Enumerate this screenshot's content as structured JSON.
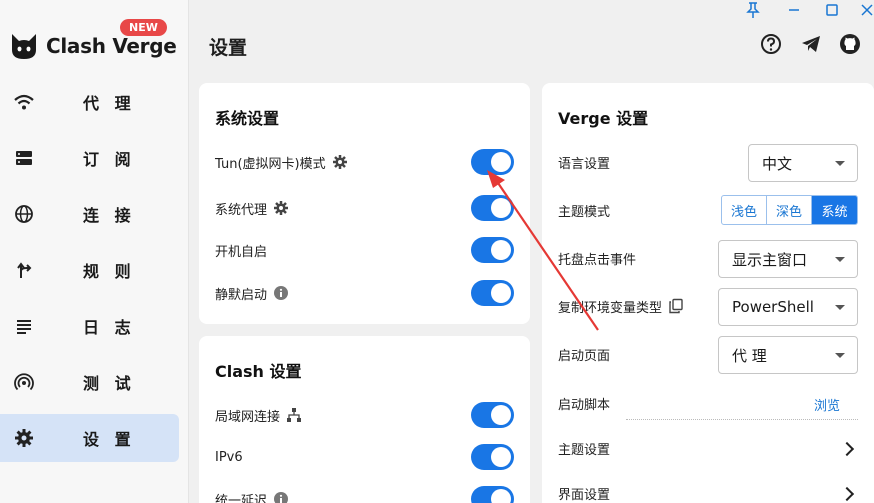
{
  "app": {
    "name": "Clash Verge",
    "badge": "NEW"
  },
  "header": {
    "title": "设置"
  },
  "nav": [
    {
      "label": "代 理",
      "icon": "wifi-icon"
    },
    {
      "label": "订 阅",
      "icon": "storage-icon"
    },
    {
      "label": "连 接",
      "icon": "globe-icon"
    },
    {
      "label": "规 则",
      "icon": "route-icon"
    },
    {
      "label": "日 志",
      "icon": "list-icon"
    },
    {
      "label": "测 试",
      "icon": "radar-icon"
    },
    {
      "label": "设 置",
      "icon": "gear-icon",
      "active": true
    }
  ],
  "system_settings": {
    "title": "系统设置",
    "rows": [
      {
        "label": "Tun(虚拟网卡)模式",
        "on": true
      },
      {
        "label": "系统代理",
        "on": true
      },
      {
        "label": "开机自启",
        "on": true
      },
      {
        "label": "静默启动",
        "on": true
      }
    ]
  },
  "clash_settings": {
    "title": "Clash 设置",
    "rows": [
      {
        "label": "局域网连接",
        "on": true
      },
      {
        "label": "IPv6",
        "on": true
      },
      {
        "label": "统一延迟",
        "on": true
      }
    ]
  },
  "verge_settings": {
    "title": "Verge 设置",
    "language": {
      "label": "语言设置",
      "value": "中文"
    },
    "theme_mode": {
      "label": "主题模式",
      "options": [
        "浅色",
        "深色",
        "系统"
      ],
      "selected": "系统"
    },
    "tray_event": {
      "label": "托盘点击事件",
      "value": "显示主窗口"
    },
    "copy_env": {
      "label": "复制环境变量类型",
      "value": "PowerShell"
    },
    "start_page": {
      "label": "启动页面",
      "value": "代 理"
    },
    "start_script": {
      "label": "启动脚本",
      "action": "浏览"
    },
    "theme_settings": {
      "label": "主题设置"
    },
    "ui_settings": {
      "label": "界面设置"
    }
  },
  "colors": {
    "accent": "#1976e5",
    "active_nav": "#d5e3f7",
    "badge": "#e84848",
    "arrow": "#e53935"
  }
}
